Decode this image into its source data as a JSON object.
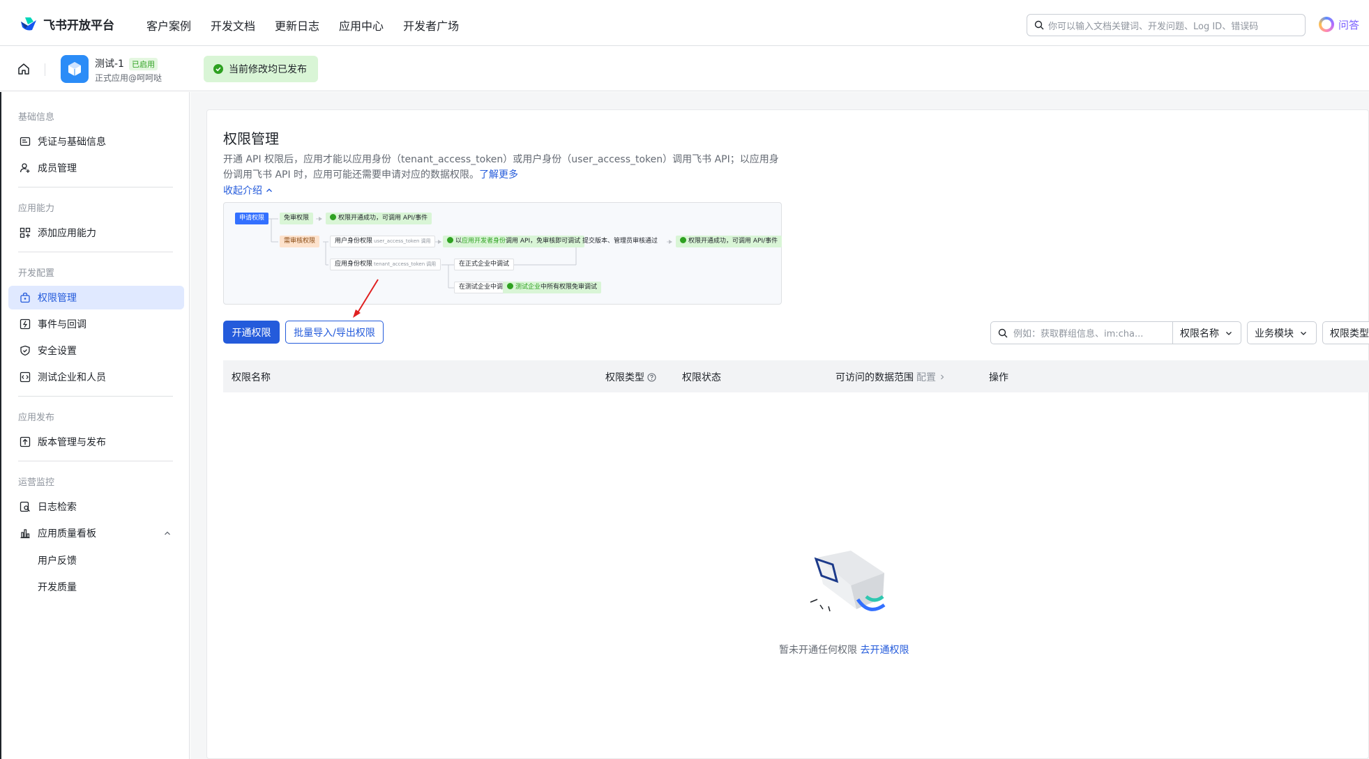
{
  "header": {
    "brand": "飞书开放平台",
    "nav": [
      "客户案例",
      "开发文档",
      "更新日志",
      "应用中心",
      "开发者广场"
    ],
    "search_placeholder": "你可以输入文档关键词、开发问题、Log ID、错误码",
    "qa_label": "问答"
  },
  "appbar": {
    "app_name": "测试-1",
    "status_badge": "已启用",
    "app_subtitle": "正式应用@呵呵哒",
    "publish_status": "当前修改均已发布"
  },
  "sidebar": {
    "groups": [
      {
        "title": "基础信息",
        "items": [
          "凭证与基础信息",
          "成员管理"
        ]
      },
      {
        "title": "应用能力",
        "items": [
          "添加应用能力"
        ]
      },
      {
        "title": "开发配置",
        "items": [
          "权限管理",
          "事件与回调",
          "安全设置",
          "测试企业和人员"
        ]
      },
      {
        "title": "应用发布",
        "items": [
          "版本管理与发布"
        ]
      },
      {
        "title": "运营监控",
        "items": [
          "日志检索",
          "应用质量看板"
        ]
      }
    ],
    "sub_items": [
      "用户反馈",
      "开发质量"
    ],
    "active_item": "权限管理"
  },
  "main": {
    "title": "权限管理",
    "description": "开通 API 权限后，应用才能以应用身份（tenant_access_token）或用户身份（user_access_token）调用飞书 API；以应用身份调用飞书 API 时，应用可能还需要申请对应的数据权限。",
    "learn_more": "了解更多",
    "collapse_label": "收起介绍",
    "flow": {
      "apply": "申请权限",
      "no_review": "免审权限",
      "success": "权限开通成功，可调用 API/事件",
      "need_review": "需审核权限",
      "user_identity": "用户身份权限",
      "user_token": "user_access_token",
      "app_identity": "应用身份权限",
      "tenant_token": "tenant_access_token",
      "call_suffix": "调用",
      "dev_identity_prefix": "以",
      "dev_identity_hl": "应用开发者身份",
      "dev_identity_suffix": "调用 API，免审核即可调试",
      "submit": "提交版本、管理员审核通过",
      "prod_debug": "在正式企业中调试",
      "test_debug": "在测试企业中调试",
      "test_all_prefix": "测试企业",
      "test_all_suffix": "中所有权限免审调试"
    },
    "buttons": {
      "open": "开通权限",
      "batch": "批量导入/导出权限"
    },
    "filters": {
      "search_placeholder": "例如：获取群组信息、im:cha...",
      "name_select": "权限名称",
      "module_select": "业务模块",
      "type_select": "权限类型"
    },
    "table": {
      "columns": [
        "权限名称",
        "权限类型",
        "权限状态",
        "可访问的数据范围",
        "操作"
      ],
      "config_label": "配置"
    },
    "empty": {
      "text": "暂未开通任何权限",
      "link": "去开通权限"
    }
  },
  "colors": {
    "primary": "#245bdb",
    "active_bg": "#e0e9ff",
    "success_bg": "#d9f5d6",
    "success": "#2ea121"
  }
}
